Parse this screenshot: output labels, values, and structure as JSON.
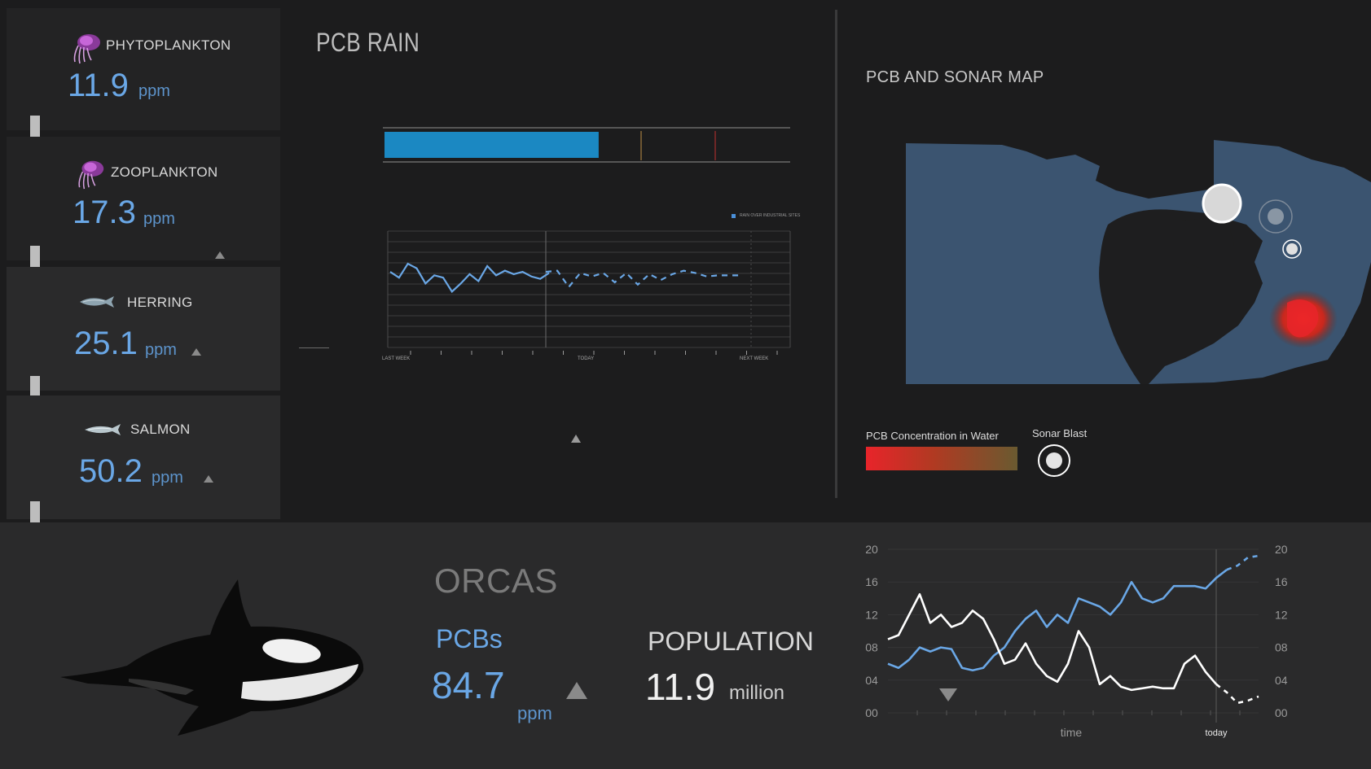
{
  "food_chain": [
    {
      "name": "PHYTOPLANKTON",
      "value": "11.9",
      "unit": "ppm",
      "icon": "plankton-icon",
      "trend": "none"
    },
    {
      "name": "ZOOPLANKTON",
      "value": "17.3",
      "unit": "ppm",
      "icon": "plankton-icon",
      "trend": "up"
    },
    {
      "name": "HERRING",
      "value": "25.1",
      "unit": "ppm",
      "icon": "fish-icon",
      "trend": "up"
    },
    {
      "name": "SALMON",
      "value": "50.2",
      "unit": "ppm",
      "icon": "fish-icon",
      "trend": "up"
    }
  ],
  "pcb_rain": {
    "title": "PCB RAIN",
    "level_fraction": 0.53,
    "legend_label": "RAIN OVER INDUSTRIAL SITES",
    "x_labels": [
      "LAST WEEK",
      "TODAY",
      "NEXT WEEK"
    ]
  },
  "map": {
    "title": "PCB AND SONAR MAP",
    "legend_pcb": "PCB Concentration in Water",
    "legend_sonar": "Sonar Blast",
    "colors": {
      "water": "#3b5470",
      "land": "#1e1e1f",
      "pcb_high": "#e8242a",
      "pcb_low": "#7a6a3a"
    }
  },
  "orcas": {
    "title": "ORCAS",
    "pcb_label": "PCBs",
    "pcb_value": "84.7",
    "pcb_unit": "ppm",
    "population_label": "POPULATION",
    "population_value": "11.9",
    "population_unit": "million"
  },
  "chart_data": {
    "type": "line",
    "x_labels": [
      "time",
      "today"
    ],
    "y_ticks": [
      "00",
      "04",
      "08",
      "12",
      "16",
      "20"
    ],
    "ylim": [
      0,
      20
    ],
    "series": [
      {
        "color": "#6aa7e6",
        "x": [
          0,
          1,
          2,
          3,
          4,
          5,
          6,
          7,
          8,
          9,
          10,
          11,
          12,
          13,
          14,
          15,
          16,
          17,
          18,
          19,
          20,
          21,
          22,
          23,
          24,
          25,
          26,
          27,
          28,
          29,
          30,
          31,
          32,
          33,
          34,
          35
        ],
        "y": [
          6,
          5.5,
          6.5,
          8,
          7.5,
          8,
          7.8,
          5.5,
          5.2,
          5.5,
          7,
          8,
          10,
          11.5,
          12.5,
          10.5,
          12,
          11,
          14,
          13.5,
          13,
          12,
          13.5,
          16,
          14,
          13.5,
          14,
          15.5,
          15.5,
          15.5,
          15.2,
          16.5,
          17.5,
          18,
          19,
          19.2
        ],
        "projected_from": 32
      },
      {
        "color": "#ffffff",
        "x": [
          0,
          1,
          2,
          3,
          4,
          5,
          6,
          7,
          8,
          9,
          10,
          11,
          12,
          13,
          14,
          15,
          16,
          17,
          18,
          19,
          20,
          21,
          22,
          23,
          24,
          25,
          26,
          27,
          28,
          29,
          30,
          31,
          32,
          33,
          34,
          35
        ],
        "y": [
          9,
          9.5,
          12,
          14.5,
          11,
          12,
          10.5,
          11,
          12.5,
          11.5,
          9,
          6,
          6.5,
          8.5,
          6,
          4.5,
          3.8,
          6,
          10,
          8,
          3.5,
          4.5,
          3.2,
          2.8,
          3,
          3.2,
          3,
          3,
          6,
          7,
          5,
          3.5,
          2.5,
          1.2,
          1.5,
          2
        ],
        "projected_from": 31
      }
    ],
    "today_index": 31
  },
  "rain_chart": {
    "series": [
      {
        "y": [
          6.5,
          6,
          7.2,
          6.8,
          5.5,
          6.2,
          6,
          4.8,
          5.5,
          6.3,
          5.7,
          7,
          6.2,
          6.6,
          6.3,
          6.5,
          6.1,
          5.9,
          6.4
        ]
      },
      {
        "y": [
          6.5,
          6.6,
          5.2,
          6.4,
          6.1,
          6.4,
          5.6,
          6.4,
          5.4,
          6.3,
          5.8,
          6.3,
          6.6,
          6.4,
          6.1,
          6.2,
          6.2,
          6.2
        ]
      }
    ]
  }
}
